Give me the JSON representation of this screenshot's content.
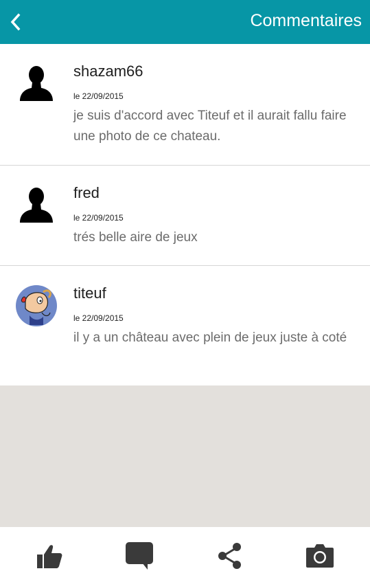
{
  "header": {
    "title": "Commentaires",
    "back_icon": "chevron-left-icon",
    "background": "#0796a6"
  },
  "comments": [
    {
      "username": "shazam66",
      "date": "le 22/09/2015",
      "text": "je suis d'accord avec Titeuf et il aurait fallu faire une photo de ce chateau.",
      "avatar": "silhouette-avatar"
    },
    {
      "username": "fred",
      "date": "le 22/09/2015",
      "text": "trés belle aire de jeux",
      "avatar": "silhouette-avatar"
    },
    {
      "username": "titeuf",
      "date": "le 22/09/2015",
      "text": "il y a un château avec plein de jeux juste à coté",
      "avatar": "titeuf-avatar"
    }
  ],
  "bottom_bar": {
    "icons": [
      "thumbs-up-icon",
      "comment-icon",
      "share-icon",
      "camera-icon"
    ],
    "icon_color": "#3a3a3a"
  }
}
